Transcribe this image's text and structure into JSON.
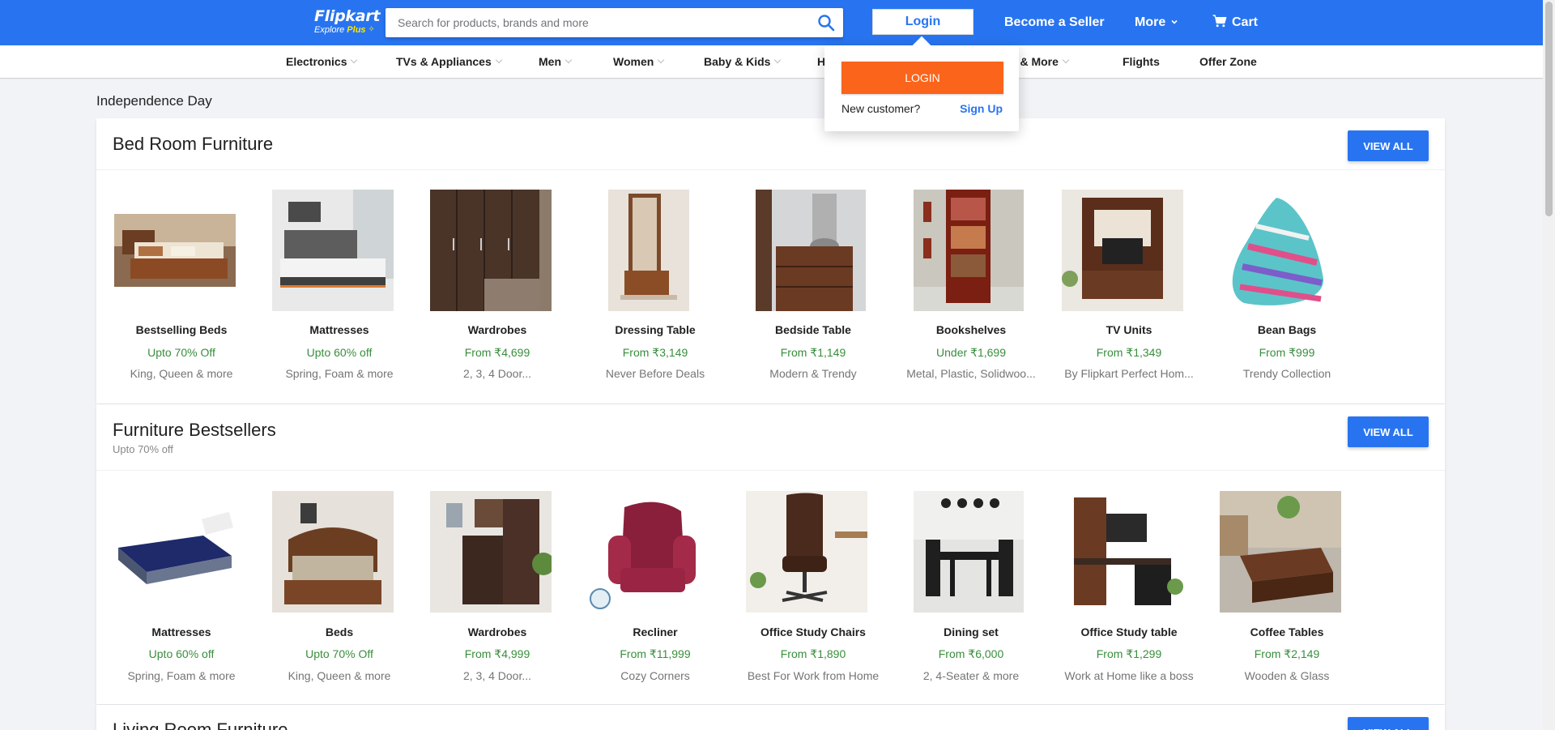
{
  "header": {
    "logo_text": "Flipkart",
    "logo_sub_explore": "Explore",
    "logo_sub_plus": "Plus",
    "search_placeholder": "Search for products, brands and more",
    "login_label": "Login",
    "become_seller_label": "Become a Seller",
    "more_label": "More",
    "cart_label": "Cart",
    "brand_color": "#2874f0"
  },
  "categories": [
    {
      "label": "Electronics"
    },
    {
      "label": "TVs & Appliances"
    },
    {
      "label": "Men"
    },
    {
      "label": "Women"
    },
    {
      "label": "Baby & Kids"
    },
    {
      "label": "H"
    },
    {
      "label": "ks & More"
    },
    {
      "label": "Flights"
    },
    {
      "label": "Offer Zone"
    }
  ],
  "login_dropdown": {
    "login_button": "LOGIN",
    "new_customer": "New customer?",
    "signup": "Sign Up",
    "accent_color": "#fb641b"
  },
  "page_title": "Independence Day",
  "sections": [
    {
      "title": "Bed Room Furniture",
      "view_all": "VIEW ALL",
      "items": [
        {
          "name": "Bestselling Beds",
          "price": "Upto 70% Off",
          "desc": "King, Queen & more"
        },
        {
          "name": "Mattresses",
          "price": "Upto 60% off",
          "desc": "Spring, Foam & more"
        },
        {
          "name": "Wardrobes",
          "price": "From ₹4,699",
          "desc": "2, 3, 4 Door..."
        },
        {
          "name": "Dressing Table",
          "price": "From ₹3,149",
          "desc": "Never Before Deals"
        },
        {
          "name": "Bedside Table",
          "price": "From ₹1,149",
          "desc": "Modern & Trendy"
        },
        {
          "name": "Bookshelves",
          "price": "Under ₹1,699",
          "desc": "Metal, Plastic, Solidwoo..."
        },
        {
          "name": "TV Units",
          "price": "From ₹1,349",
          "desc": "By Flipkart Perfect Hom..."
        },
        {
          "name": "Bean Bags",
          "price": "From ₹999",
          "desc": "Trendy Collection"
        }
      ]
    },
    {
      "title": "Furniture Bestsellers",
      "subtitle": "Upto 70% off",
      "view_all": "VIEW ALL",
      "items": [
        {
          "name": "Mattresses",
          "price": "Upto 60% off",
          "desc": "Spring, Foam & more"
        },
        {
          "name": "Beds",
          "price": "Upto 70% Off",
          "desc": "King, Queen & more"
        },
        {
          "name": "Wardrobes",
          "price": "From ₹4,999",
          "desc": "2, 3, 4 Door..."
        },
        {
          "name": "Recliner",
          "price": "From ₹11,999",
          "desc": "Cozy Corners"
        },
        {
          "name": "Office Study Chairs",
          "price": "From ₹1,890",
          "desc": "Best For Work from Home"
        },
        {
          "name": "Dining set",
          "price": "From ₹6,000",
          "desc": "2, 4-Seater & more"
        },
        {
          "name": "Office Study table",
          "price": "From ₹1,299",
          "desc": "Work at Home like a boss"
        },
        {
          "name": "Coffee Tables",
          "price": "From ₹2,149",
          "desc": "Wooden & Glass"
        }
      ]
    },
    {
      "title": "Living Room Furniture",
      "view_all": "VIEW ALL"
    }
  ]
}
